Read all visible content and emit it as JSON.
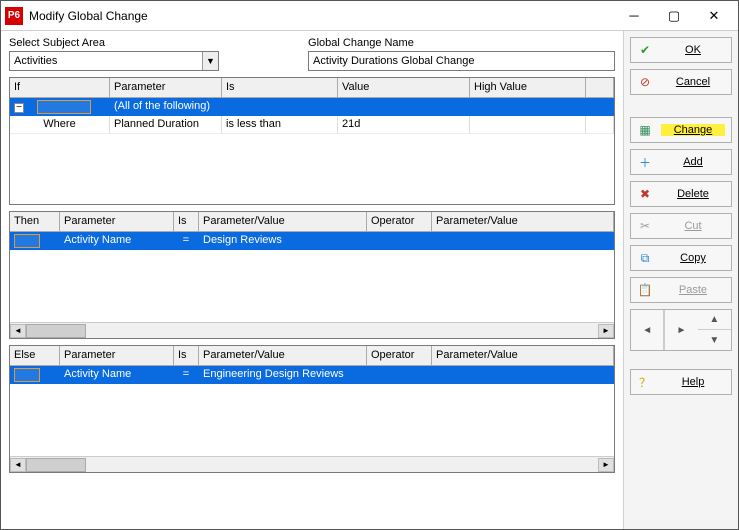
{
  "window": {
    "app_badge": "P6",
    "title": "Modify Global Change"
  },
  "labels": {
    "select_subject_area": "Select Subject Area",
    "global_change_name": "Global Change Name"
  },
  "subject_area": {
    "value": "Activities"
  },
  "change_name": {
    "value": "Activity Durations Global Change"
  },
  "if_grid": {
    "headers": {
      "c1": "If",
      "c2": "Parameter",
      "c3": "Is",
      "c4": "Value",
      "c5": "High Value",
      "c6": ""
    },
    "rows": [
      {
        "selected": true,
        "c1_toggle": "−",
        "c2": "(All of the following)",
        "c3": "",
        "c4": "",
        "c5": ""
      },
      {
        "selected": false,
        "c1_text": "Where",
        "c2": "Planned Duration",
        "c3": "is less than",
        "c4": "21d",
        "c5": ""
      }
    ]
  },
  "then_grid": {
    "headers": {
      "c1": "Then",
      "c2": "Parameter",
      "c3": "Is",
      "c4": "Parameter/Value",
      "c5": "Operator",
      "c6": "Parameter/Value"
    },
    "rows": [
      {
        "selected": true,
        "c2": "Activity Name",
        "c3": "=",
        "c4": "Design Reviews",
        "c5": "",
        "c6": ""
      }
    ]
  },
  "else_grid": {
    "headers": {
      "c1": "Else",
      "c2": "Parameter",
      "c3": "Is",
      "c4": "Parameter/Value",
      "c5": "Operator",
      "c6": "Parameter/Value"
    },
    "rows": [
      {
        "selected": true,
        "c2": "Activity Name",
        "c3": "=",
        "c4": "Engineering Design Reviews",
        "c5": "",
        "c6": ""
      }
    ]
  },
  "buttons": {
    "ok": "OK",
    "cancel": "Cancel",
    "change": "Change",
    "add": "Add",
    "delete": "Delete",
    "cut": "Cut",
    "copy": "Copy",
    "paste": "Paste",
    "help": "Help"
  }
}
